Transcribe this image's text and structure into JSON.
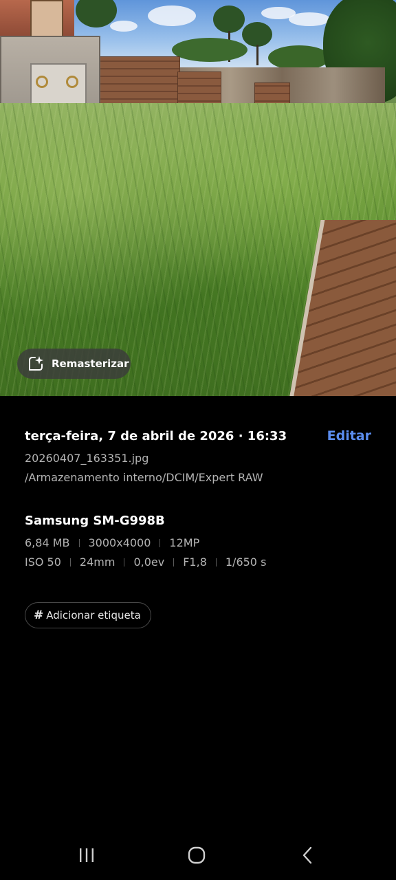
{
  "photo": {
    "remaster_label": "Remasterizar",
    "remaster_icon": "sparkle-frame-icon"
  },
  "details": {
    "datetime": "terça-feira, 7 de abril de 2026 · 16:33",
    "edit_label": "Editar",
    "filename": "20260407_163351.jpg",
    "path": "/Armazenamento interno/DCIM/Expert RAW",
    "device": "Samsung SM-G998B",
    "file_info": [
      "6,84 MB",
      "3000x4000",
      "12MP"
    ],
    "camera_info": [
      "ISO 50",
      "24mm",
      "0,0ev",
      "F1,8",
      "1/650 s"
    ],
    "tag_label": "Adicionar etiqueta"
  },
  "navbar": {
    "recents_icon": "recent-apps-icon",
    "home_icon": "home-icon",
    "back_icon": "back-icon"
  },
  "colors": {
    "accent": "#5b8def",
    "background": "#000000",
    "secondary_text": "#b3b3b3"
  }
}
